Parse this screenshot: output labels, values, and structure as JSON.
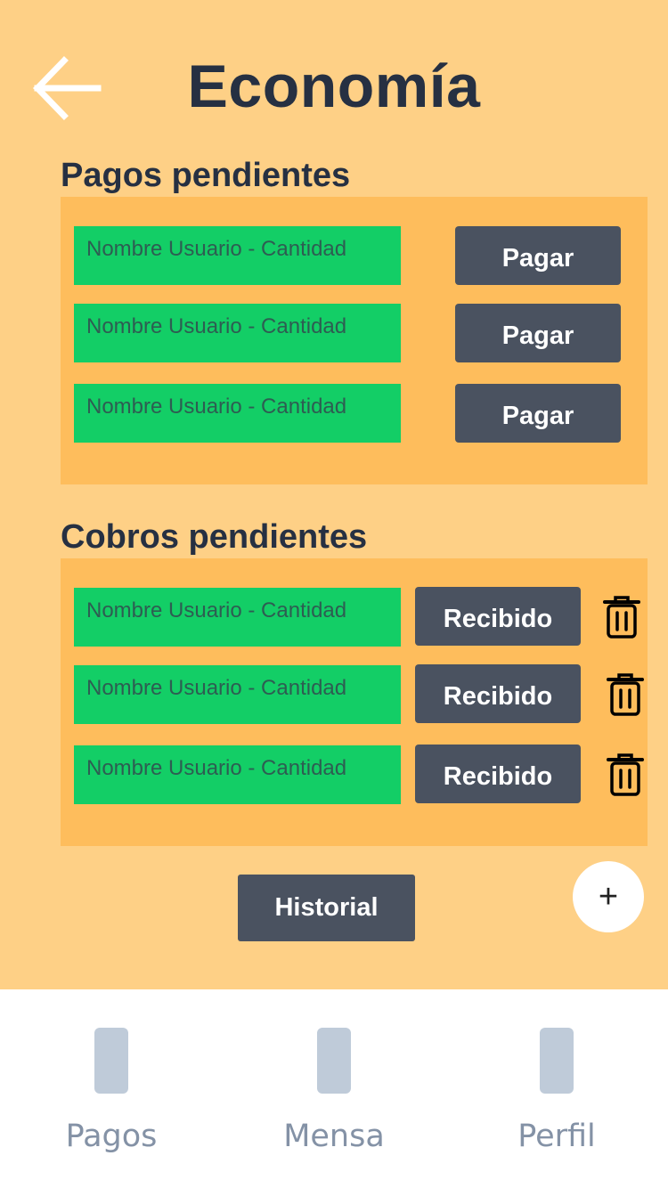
{
  "header": {
    "title": "Economía",
    "back_icon": "arrow-left-icon"
  },
  "pending_payments": {
    "title": "Pagos pendientes",
    "items": [
      {
        "label": "Nombre Usuario - Cantidad",
        "action": "Pagar"
      },
      {
        "label": "Nombre Usuario - Cantidad",
        "action": "Pagar"
      },
      {
        "label": "Nombre Usuario - Cantidad",
        "action": "Pagar"
      }
    ]
  },
  "pending_collections": {
    "title": "Cobros pendientes",
    "items": [
      {
        "label": "Nombre Usuario - Cantidad",
        "action": "Recibido",
        "delete_icon": "trash-icon"
      },
      {
        "label": "Nombre Usuario - Cantidad",
        "action": "Recibido",
        "delete_icon": "trash-icon"
      },
      {
        "label": "Nombre Usuario - Cantidad",
        "action": "Recibido",
        "delete_icon": "trash-icon"
      }
    ]
  },
  "history_button": "Historial",
  "fab": {
    "symbol": "+",
    "icon": "plus-icon"
  },
  "bottom_nav": [
    {
      "label": "Pagos",
      "icon": "placeholder-icon"
    },
    {
      "label": "Mensa",
      "icon": "placeholder-icon"
    },
    {
      "label": "Perfil",
      "icon": "placeholder-icon"
    }
  ],
  "colors": {
    "background": "#fed086",
    "panel": "#febd5c",
    "field": "#13ce66",
    "button": "#4a5260",
    "title_text": "#263042",
    "nav_icon": "#bfcbd9",
    "nav_text": "#8492a6"
  }
}
